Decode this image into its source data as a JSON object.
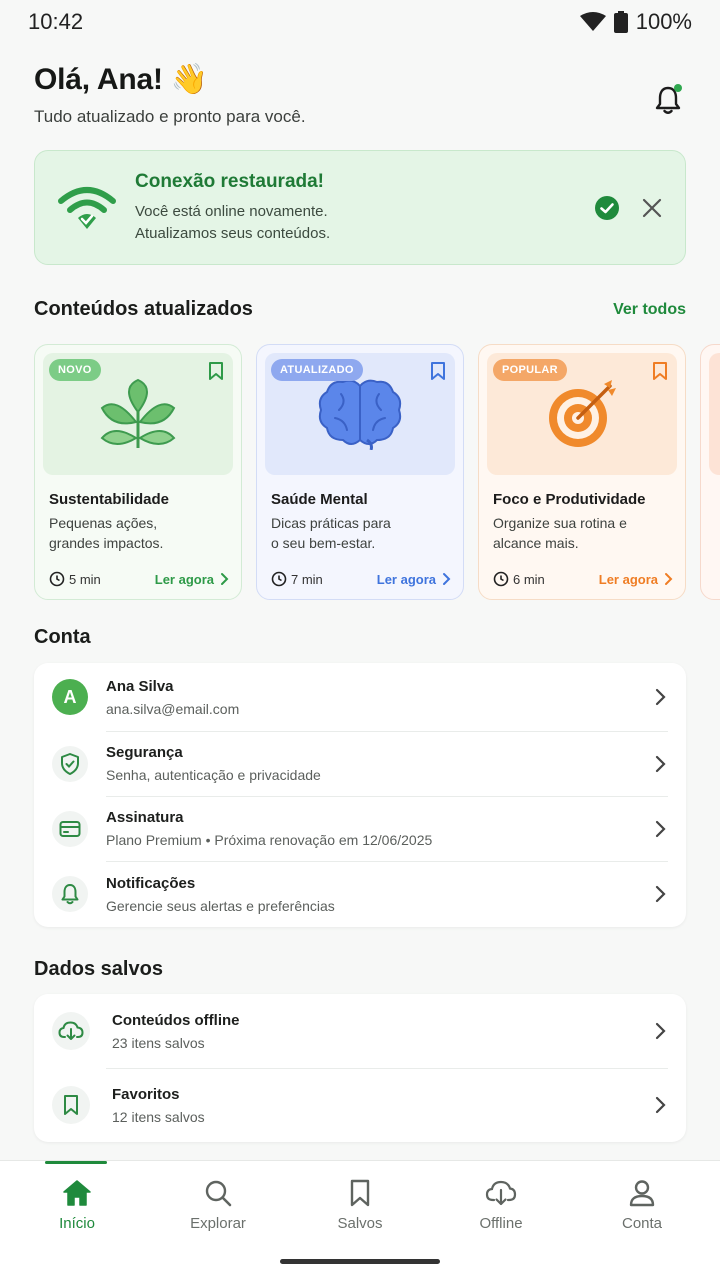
{
  "status_bar": {
    "time": "10:42",
    "battery": "100%"
  },
  "header": {
    "greeting": "Olá, Ana! 👋",
    "subtitle": "Tudo atualizado e pronto para você."
  },
  "banner": {
    "title": "Conexão restaurada!",
    "line1": "Você está online novamente.",
    "line2": "Atualizamos seus conteúdos.",
    "color": "#1f7a36"
  },
  "updated": {
    "title": "Conteúdos atualizados",
    "see_all": "Ver todos",
    "cards": [
      {
        "badge": "NOVO",
        "title": "Sustentabilidade",
        "desc1": "Pequenas ações,",
        "desc2": "grandes impactos.",
        "time": "5 min",
        "cta": "Ler agora",
        "icon": "leaf-icon",
        "accent": "#2e9a48"
      },
      {
        "badge": "ATUALIZADO",
        "title": "Saúde Mental",
        "desc1": "Dicas práticas para",
        "desc2": "o seu bem-estar.",
        "time": "7 min",
        "cta": "Ler agora",
        "icon": "brain-icon",
        "accent": "#3f74dd"
      },
      {
        "badge": "POPULAR",
        "title": "Foco e Produtividade",
        "desc1": "Organize sua rotina e",
        "desc2": "alcance mais.",
        "time": "6 min",
        "cta": "Ler agora",
        "icon": "target-icon",
        "accent": "#ef7d24"
      }
    ]
  },
  "account": {
    "title": "Conta",
    "rows": [
      {
        "title": "Ana Silva",
        "sub": "ana.silva@email.com",
        "icon": "avatar",
        "avatar_letter": "A"
      },
      {
        "title": "Segurança",
        "sub": "Senha, autenticação e privacidade",
        "icon": "shield-icon"
      },
      {
        "title": "Assinatura",
        "sub": "Plano Premium • Próxima renovação em 12/06/2025",
        "icon": "card-icon"
      },
      {
        "title": "Notificações",
        "sub": "Gerencie seus alertas e preferências",
        "icon": "bell-icon"
      }
    ]
  },
  "saved": {
    "title": "Dados salvos",
    "rows": [
      {
        "title": "Conteúdos offline",
        "sub": "23 itens salvos",
        "icon": "cloud-download-icon"
      },
      {
        "title": "Favoritos",
        "sub": "12 itens salvos",
        "icon": "bookmark-icon"
      }
    ]
  },
  "nav": {
    "items": [
      {
        "label": "Início",
        "icon": "home-icon",
        "active": true
      },
      {
        "label": "Explorar",
        "icon": "search-icon"
      },
      {
        "label": "Salvos",
        "icon": "bookmark-icon"
      },
      {
        "label": "Offline",
        "icon": "cloud-download-icon"
      },
      {
        "label": "Conta",
        "icon": "user-icon"
      }
    ]
  }
}
